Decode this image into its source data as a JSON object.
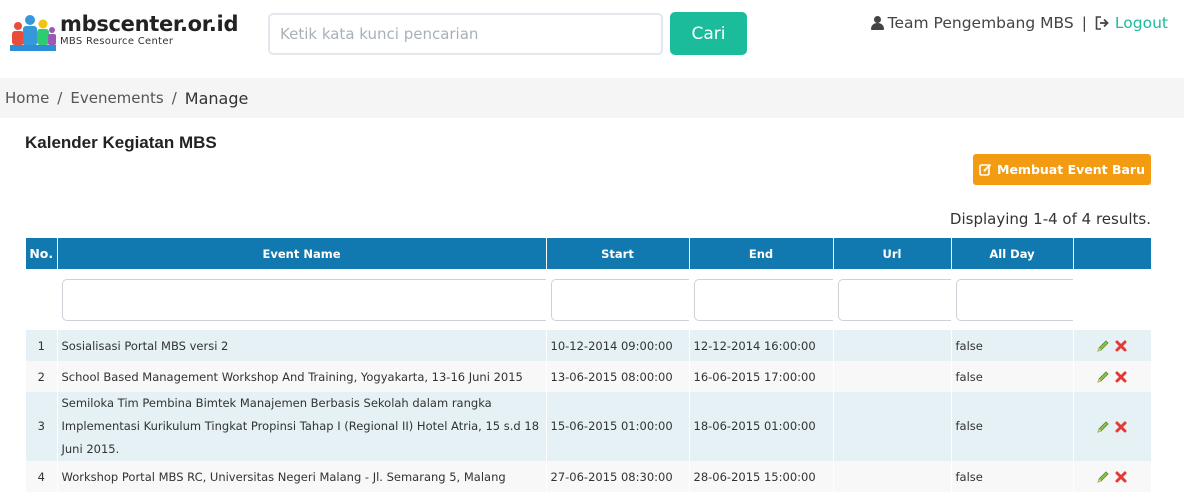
{
  "header": {
    "logo_title": "mbscenter.or.id",
    "logo_subtitle": "MBS Resource Center",
    "search_placeholder": "Ketik kata kunci pencarian",
    "search_button": "Cari",
    "user_name": "Team Pengembang MBS",
    "separator": "|",
    "logout_label": "Logout"
  },
  "breadcrumb": {
    "items": [
      "Home",
      "Evenements"
    ],
    "active": "Manage",
    "divider": "/"
  },
  "page": {
    "title": "Kalender Kegiatan MBS",
    "create_button": "Membuat Event Baru",
    "summary": "Displaying 1-4 of 4 results."
  },
  "table": {
    "columns": [
      "No.",
      "Event Name",
      "Start",
      "End",
      "Url",
      "All Day"
    ],
    "rows": [
      {
        "no": "1",
        "name": "Sosialisasi Portal MBS versi 2",
        "start": "10-12-2014 09:00:00",
        "end": "12-12-2014 16:00:00",
        "url": "",
        "all_day": "false"
      },
      {
        "no": "2",
        "name": "School Based Management Workshop And Training, Yogyakarta, 13-16 Juni 2015",
        "start": "13-06-2015 08:00:00",
        "end": "16-06-2015 17:00:00",
        "url": "",
        "all_day": "false"
      },
      {
        "no": "3",
        "name": "Semiloka Tim Pembina Bimtek Manajemen Berbasis Sekolah dalam rangka Implementasi Kurikulum Tingkat Propinsi Tahap I (Regional II) Hotel Atria, 15 s.d 18 Juni 2015.",
        "start": "15-06-2015 01:00:00",
        "end": "18-06-2015 01:00:00",
        "url": "",
        "all_day": "false"
      },
      {
        "no": "4",
        "name": "Workshop Portal MBS RC, Universitas Negeri Malang - Jl. Semarang 5, Malang",
        "start": "27-06-2015 08:30:00",
        "end": "28-06-2015 15:00:00",
        "url": "",
        "all_day": "false"
      }
    ]
  },
  "colors": {
    "accent": "#1abc9c",
    "table_header": "#1279b0",
    "create_button": "#f39c12",
    "row_odd": "#e5f1f4",
    "row_even": "#f8f8f8"
  },
  "icons": {
    "user": "user-icon",
    "logout": "logout-icon",
    "create": "edit-icon",
    "update": "pencil-icon",
    "delete": "delete-icon"
  }
}
